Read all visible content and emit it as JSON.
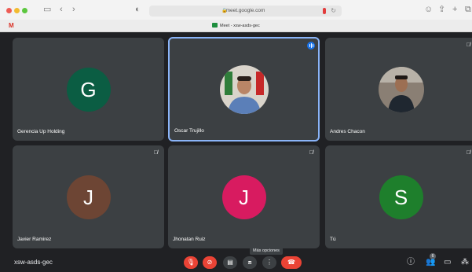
{
  "browser": {
    "url": "meet.google.com",
    "tab_title": "Meet - xsw-asds-gec",
    "gmail_glyph": "M"
  },
  "participants": [
    {
      "name": "Gerencia Up Holding",
      "initial": "G",
      "avatar_color": "#0b5d43",
      "type": "initial",
      "muted": false,
      "speaking": false
    },
    {
      "name": "Oscar Trujillo",
      "initial": "",
      "type": "photo",
      "muted": false,
      "speaking": true
    },
    {
      "name": "Andres Chacon",
      "initial": "",
      "type": "photo",
      "muted": true,
      "speaking": false
    },
    {
      "name": "Javier Ramirez",
      "initial": "J",
      "avatar_color": "#6d4534",
      "type": "initial",
      "muted": true,
      "speaking": false
    },
    {
      "name": "Jhonatan Ruiz",
      "initial": "J",
      "avatar_color": "#d81b60",
      "type": "initial",
      "muted": true,
      "speaking": false
    },
    {
      "name": "Tú",
      "initial": "S",
      "avatar_color": "#1e7f2c",
      "type": "initial",
      "muted": true,
      "speaking": false
    }
  ],
  "meeting": {
    "code": "xsw-asds-gec",
    "tooltip": "Más opciones",
    "people_count": "6"
  },
  "colors": {
    "meet_bg": "#202124",
    "tile_bg": "#3c4043",
    "danger": "#ea4335",
    "active_border": "#8ab4f8"
  }
}
